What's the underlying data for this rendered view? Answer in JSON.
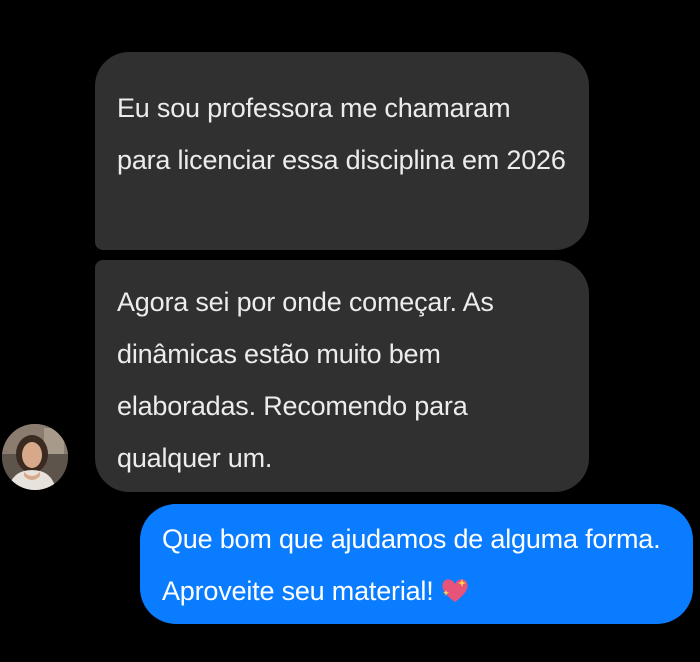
{
  "conversation": {
    "messages": [
      {
        "sender": "contact",
        "text": "Eu sou professora me chamaram para licenciar essa disciplina em 2026"
      },
      {
        "sender": "contact",
        "text": "Agora sei por onde começar. As dinâmicas estão muito bem elaboradas. Recomendo para qualquer um."
      },
      {
        "sender": "me",
        "text": "Que bom que ajudamos de alguma forma. Aproveite seu material!",
        "emoji": "sparkling-heart-icon"
      }
    ],
    "contact_avatar": "contact-avatar-photo"
  },
  "colors": {
    "background": "#000000",
    "incoming_bubble": "#303030",
    "incoming_text": "#ececec",
    "outgoing_bubble": "#0a7cff",
    "outgoing_text": "#ffffff"
  }
}
